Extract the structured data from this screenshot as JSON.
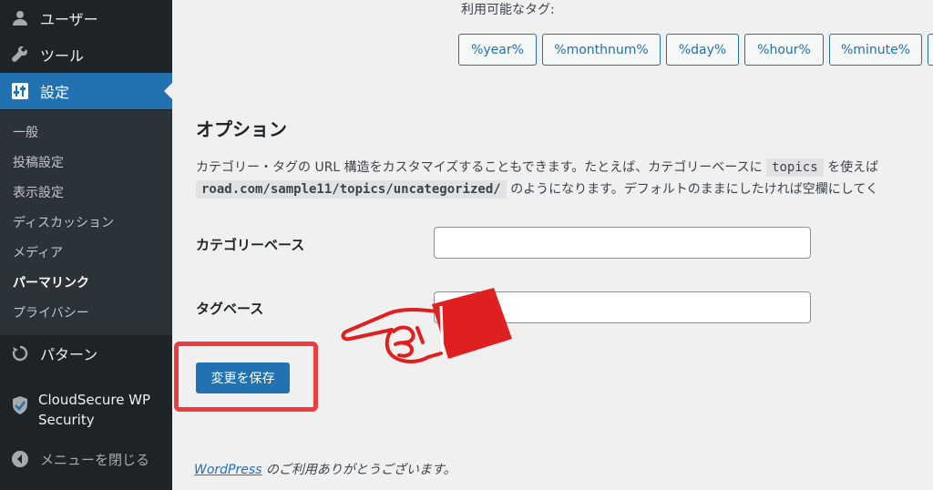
{
  "sidebar": {
    "items_top": [
      {
        "label": "ユーザー",
        "icon": "user-icon"
      },
      {
        "label": "ツール",
        "icon": "wrench-icon"
      },
      {
        "label": "設定",
        "icon": "settings-icon"
      }
    ],
    "submenu": [
      "一般",
      "投稿設定",
      "表示設定",
      "ディスカッション",
      "メディア",
      "パーマリンク",
      "プライバシー"
    ],
    "pattern": "パターン",
    "cloudsecure": "CloudSecure WP Security",
    "cloudsecure_line1": "CloudSecure WP",
    "cloudsecure_line2": "Security",
    "collapse": "メニューを閉じる"
  },
  "main": {
    "available_tags_label": "利用可能なタグ:",
    "tags": [
      "%year%",
      "%monthnum%",
      "%day%",
      "%hour%",
      "%minute%"
    ],
    "options_title": "オプション",
    "desc_line1_pre": "カテゴリー・タグの URL 構造をカスタマイズすることもできます。たとえば、カテゴリーベースに",
    "desc_code1": "topics",
    "desc_line1_post": "を使えば",
    "desc_code2": "road.com/sample11/topics/uncategorized/",
    "desc_line2_post": "のようになります。デフォルトのままにしたければ空欄にしてく",
    "category_base_label": "カテゴリーベース",
    "category_base_value": "",
    "tag_base_label": "タグベース",
    "tag_base_value": "",
    "save_button": "変更を保存",
    "footer_link": "WordPress",
    "footer_text": " のご利用ありがとうございます。"
  },
  "colors": {
    "sidebar_bg": "#1d2327",
    "accent": "#2271b1",
    "highlight": "#ef3b3b"
  }
}
